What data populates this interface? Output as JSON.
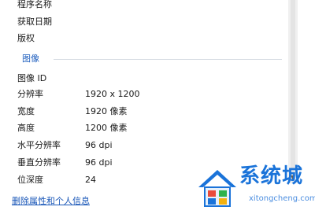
{
  "properties": {
    "top_rows": [
      {
        "label": "程序名称"
      },
      {
        "label": "获取日期"
      },
      {
        "label": "版权"
      }
    ],
    "section_title": "图像",
    "image_rows": [
      {
        "label": "图像 ID",
        "value": ""
      },
      {
        "label": "分辨率",
        "value": "1920 x 1200"
      },
      {
        "label": "宽度",
        "value": "1920 像素"
      },
      {
        "label": "高度",
        "value": "1200 像素"
      },
      {
        "label": "水平分辨率",
        "value": "96 dpi"
      },
      {
        "label": "垂直分辨率",
        "value": "96 dpi"
      },
      {
        "label": "位深度",
        "value": "24"
      }
    ]
  },
  "link_text": "删除属性和个人信息",
  "watermark": {
    "text": "系统城",
    "sub": "xitongcheng.com"
  },
  "colors": {
    "link": "#1a57b8",
    "section": "#1f5fbf",
    "logo": "#1a73d9"
  }
}
